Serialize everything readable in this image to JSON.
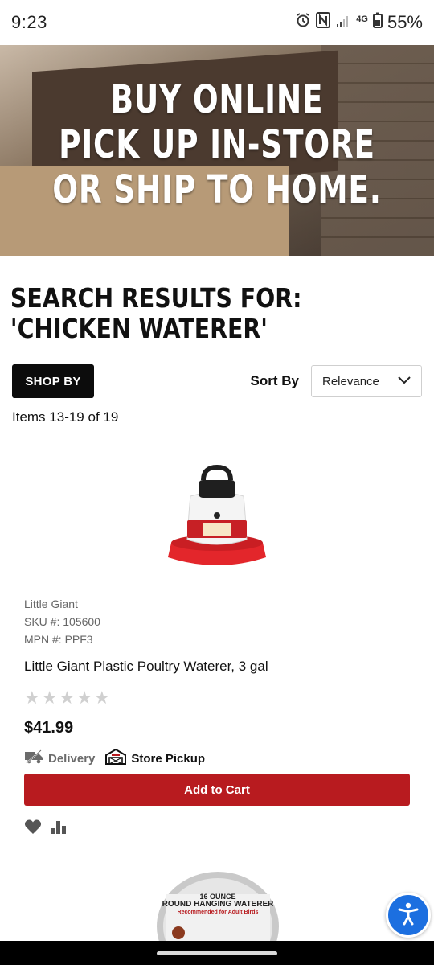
{
  "status_bar": {
    "time": "9:23",
    "network": "4G",
    "battery": "55%"
  },
  "banner": {
    "lines": [
      "BUY ONLINE",
      "PICK UP IN-STORE",
      "OR SHIP TO HOME."
    ]
  },
  "heading": "SEARCH RESULTS FOR: 'CHICKEN WATERER'",
  "controls": {
    "shop_by": "SHOP BY",
    "sort_label": "Sort By",
    "sort_value": "Relevance"
  },
  "items_count": "Items 13-19 of 19",
  "product": {
    "brand": "Little Giant",
    "sku": "SKU #: 105600",
    "mpn": "MPN #: PPF3",
    "name": "Little Giant Plastic Poultry Waterer, 3 gal",
    "rating": 0,
    "price": "$41.99",
    "delivery_label": "Delivery",
    "pickup_label": "Store Pickup",
    "add_to_cart": "Add to Cart"
  },
  "next_product": {
    "label_top": "16 OUNCE",
    "label_main": "ROUND HANGING WATERER",
    "label_sub": "Recommended for Adult Birds"
  },
  "colors": {
    "accent_red": "#b81b1f",
    "accessibility_blue": "#1c6fe0"
  }
}
